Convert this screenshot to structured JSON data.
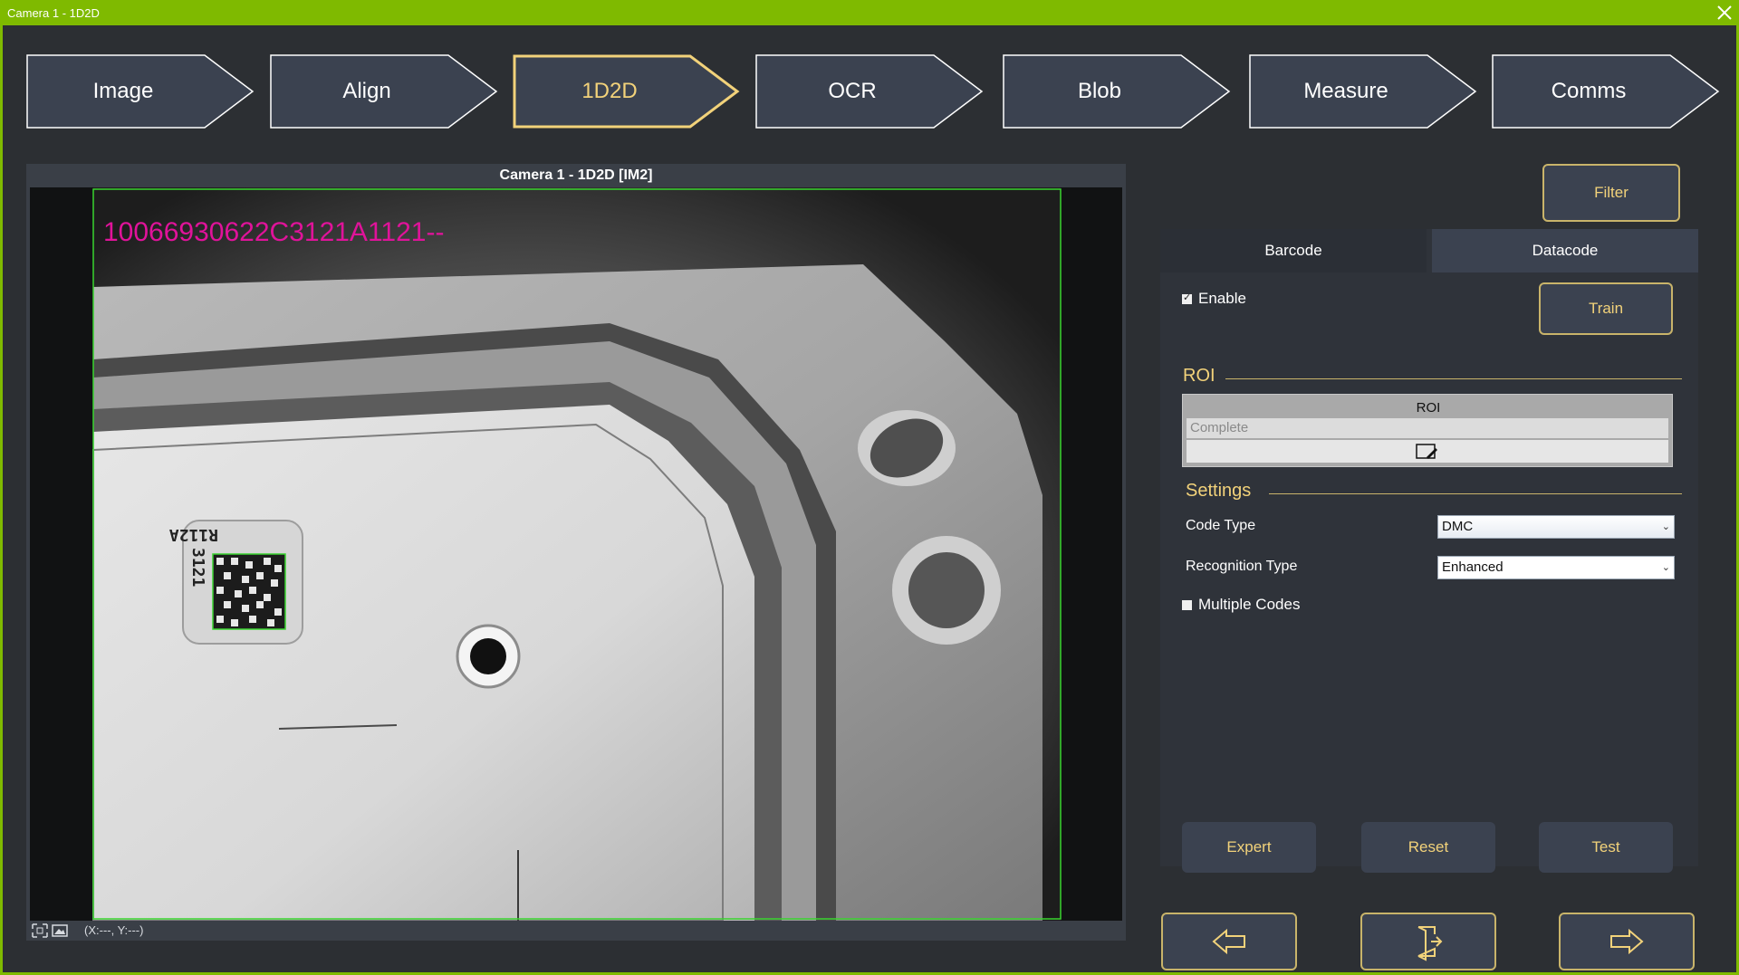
{
  "window": {
    "title": "Camera 1 - 1D2D"
  },
  "steps": [
    {
      "label": "Image",
      "active": false
    },
    {
      "label": "Align",
      "active": false
    },
    {
      "label": "1D2D",
      "active": true
    },
    {
      "label": "OCR",
      "active": false
    },
    {
      "label": "Blob",
      "active": false
    },
    {
      "label": "Measure",
      "active": false
    },
    {
      "label": "Comms",
      "active": false
    }
  ],
  "camera": {
    "header": "Camera 1 - 1D2D  [IM2]",
    "result_text": "10066930622C3121A1121--",
    "label_text_top": "R112A",
    "label_text_side": "3121",
    "coords": "(X:---, Y:---)"
  },
  "right_panel": {
    "filter_label": "Filter",
    "tabs": [
      {
        "label": "Barcode",
        "active": false
      },
      {
        "label": "Datacode",
        "active": true
      }
    ],
    "enable": {
      "label": "Enable",
      "checked": true
    },
    "train_label": "Train",
    "roi_section": "ROI",
    "roi_box": {
      "title": "ROI",
      "selected": "Complete"
    },
    "settings_section": "Settings",
    "code_type": {
      "label": "Code Type",
      "value": "DMC"
    },
    "recognition_type": {
      "label": "Recognition Type",
      "value": "Enhanced"
    },
    "multiple_codes": {
      "label": "Multiple Codes",
      "checked": false
    },
    "buttons": {
      "expert": "Expert",
      "reset": "Reset",
      "test": "Test"
    }
  },
  "colors": {
    "accent": "#7fba00",
    "gold": "#f2d27a",
    "panel": "#2c2f33",
    "result_text": "#e0139a",
    "roi_green": "#39d42e"
  },
  "icons": {
    "close": "close-icon",
    "fit": "fit-view-icon",
    "image": "image-icon",
    "roi_edit": "roi-edit-icon",
    "back": "arrow-left-icon",
    "exit": "exit-door-icon",
    "next": "arrow-right-icon"
  }
}
